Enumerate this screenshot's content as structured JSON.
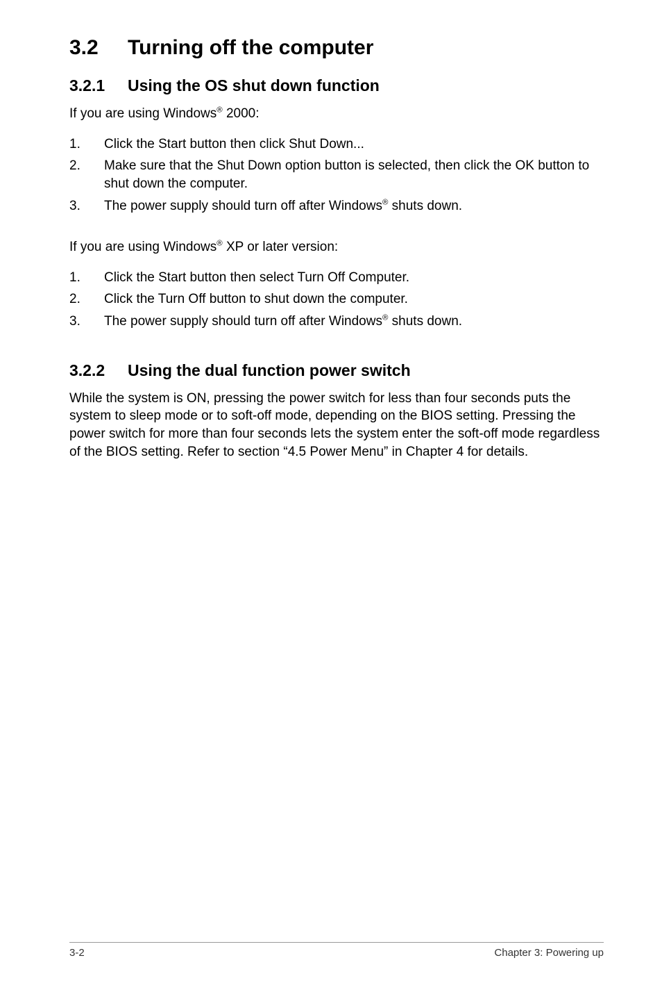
{
  "section": {
    "number": "3.2",
    "title": "Turning off the computer"
  },
  "sub1": {
    "number": "3.2.1",
    "title": "Using the OS shut down function",
    "intro_a_pre": "If you are using Windows",
    "intro_a_sup": "®",
    "intro_a_post": " 2000:",
    "list_a": {
      "i1_num": "1.",
      "i1_txt": "Click the Start button then click Shut Down...",
      "i2_num": "2.",
      "i2_txt": "Make sure that the Shut Down option button is selected, then click the OK button to shut down the computer.",
      "i3_num": "3.",
      "i3_pre": "The power supply should turn off after Windows",
      "i3_sup": "®",
      "i3_post": " shuts down."
    },
    "intro_b_pre": "If you are using Windows",
    "intro_b_sup": "®",
    "intro_b_post": " XP or later version:",
    "list_b": {
      "i1_num": "1.",
      "i1_txt": "Click the Start button then select Turn Off Computer.",
      "i2_num": "2.",
      "i2_txt": "Click the Turn Off button to shut down the computer.",
      "i3_num": "3.",
      "i3_pre": "The power supply should turn off after Windows",
      "i3_sup": "®",
      "i3_post": " shuts down."
    }
  },
  "sub2": {
    "number": "3.2.2",
    "title": "Using the dual function power switch",
    "body": "While the system is ON, pressing the power switch for less than four seconds puts the system to sleep mode or to soft-off mode, depending on the BIOS setting. Pressing the power switch for more than four seconds lets the system enter the soft-off mode regardless of the BIOS setting. Refer to section  “4.5  Power Menu” in Chapter 4 for details."
  },
  "footer": {
    "left": "3-2",
    "right": "Chapter 3: Powering up"
  }
}
